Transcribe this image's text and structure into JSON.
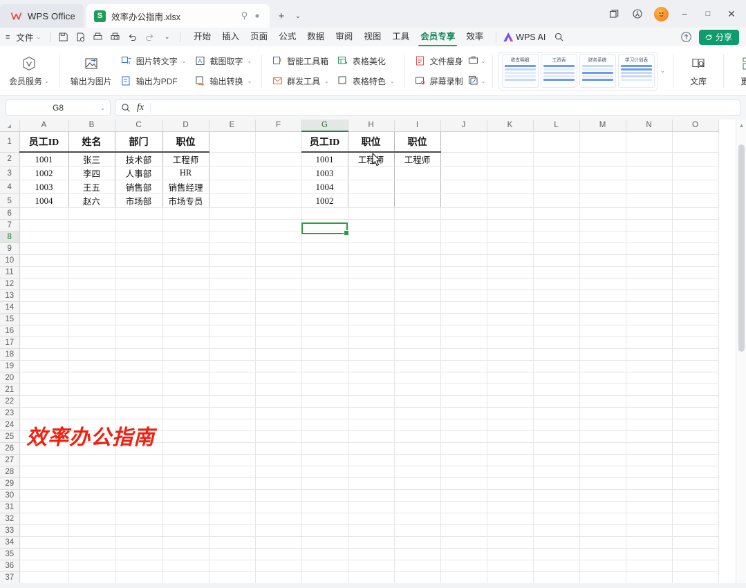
{
  "titlebar": {
    "brand": "WPS Office",
    "doc_tab": {
      "title": "效率办公指南.xlsx",
      "pin_icon": "pin-icon",
      "dot_icon": "unsaved-dot-icon"
    },
    "add_tab": "+",
    "tab_list_caret": "⌄",
    "window": {
      "restore_multi_icon": "multi-window-icon",
      "help_icon": "help-circle-icon",
      "avatar_icon": "user-avatar",
      "minimize": "−",
      "maximize": "□",
      "close": "✕"
    }
  },
  "menubar": {
    "hamburger": "≡",
    "file_label": "文件",
    "quick_access": [
      "save-icon",
      "save-as-icon",
      "print-icon",
      "print-preview-icon",
      "undo-icon",
      "redo-icon",
      "qat-more-icon"
    ],
    "tabs": [
      {
        "label": "开始",
        "active": false
      },
      {
        "label": "插入",
        "active": false
      },
      {
        "label": "页面",
        "active": false
      },
      {
        "label": "公式",
        "active": false
      },
      {
        "label": "数据",
        "active": false
      },
      {
        "label": "审阅",
        "active": false
      },
      {
        "label": "视图",
        "active": false
      },
      {
        "label": "工具",
        "active": false
      },
      {
        "label": "会员专享",
        "active": true
      },
      {
        "label": "效率",
        "active": false
      }
    ],
    "ai_label": "WPS AI",
    "search_icon": "search-icon",
    "cloud_icon": "cloud-upload-icon",
    "share_label": "分享",
    "share_color": "#0f9b6c"
  },
  "ribbon": {
    "member_service": {
      "label": "会员服务",
      "icon": "vip-badge-icon",
      "caret": "⌄"
    },
    "export_image": {
      "label": "输出为图片",
      "icon": "export-image-icon"
    },
    "stack1": [
      {
        "label": "图片转文字",
        "icon": "image-to-text-icon",
        "caret": "⌄"
      },
      {
        "label": "输出为PDF",
        "icon": "export-pdf-icon",
        "caret": ""
      }
    ],
    "stack2": [
      {
        "label": "截图取字",
        "icon": "screenshot-ocr-icon",
        "caret": "⌄"
      },
      {
        "label": "输出转换",
        "icon": "format-convert-icon",
        "caret": "⌄"
      }
    ],
    "stack3": [
      {
        "label": "智能工具箱",
        "icon": "smart-toolbox-icon",
        "caret": ""
      },
      {
        "label": "群发工具",
        "icon": "mass-mail-icon",
        "caret": "⌄"
      }
    ],
    "stack4": [
      {
        "label": "表格美化",
        "icon": "table-beautify-icon",
        "caret": ""
      },
      {
        "label": "表格特色",
        "icon": "table-feature-icon",
        "caret": "⌄"
      }
    ],
    "stack5": [
      {
        "label": "文件瘦身",
        "icon": "file-slim-icon",
        "caret": ""
      },
      {
        "label": "屏幕录制",
        "icon": "screen-record-icon",
        "caret": ""
      }
    ],
    "stack6": [
      {
        "label": "",
        "icon": "toolbox-more-icon",
        "caret": "⌄"
      },
      {
        "label": "",
        "icon": "doc-sign-icon",
        "caret": "⌄"
      }
    ],
    "templates": [
      {
        "name": "收支明细"
      },
      {
        "name": "工资表"
      },
      {
        "name": "财务系统"
      },
      {
        "name": "学习计划表"
      }
    ],
    "templates_more": "⌄",
    "library": {
      "label": "文库",
      "icon": "library-search-icon"
    },
    "more": {
      "label": "更多",
      "icon": "more-grid-icon"
    }
  },
  "formulabar": {
    "namebox_value": "G8",
    "namebox_caret": "⌄",
    "zoom_icon": "zoom-search-icon",
    "fx_label": "fx",
    "formula_value": ""
  },
  "sheet": {
    "corner_icon": "select-all-triangle",
    "columns": [
      "A",
      "B",
      "C",
      "D",
      "E",
      "F",
      "G",
      "H",
      "I",
      "J",
      "K",
      "L",
      "M",
      "N",
      "O"
    ],
    "selected_column": "G",
    "selected_row": 8,
    "selected_cell": "G8",
    "row_count": 37,
    "rows": [
      {
        "n": 1,
        "cells": {
          "A": "员工ID",
          "B": "姓名",
          "C": "部门",
          "D": "职位",
          "G": "员工ID",
          "H": "职位",
          "I": "职位"
        },
        "header": true
      },
      {
        "n": 2,
        "cells": {
          "A": "1001",
          "B": "张三",
          "C": "技术部",
          "D": "工程师",
          "G": "1001",
          "H": "工程师",
          "I": "工程师"
        }
      },
      {
        "n": 3,
        "cells": {
          "A": "1002",
          "B": "李四",
          "C": "人事部",
          "D": "HR",
          "G": "1003"
        }
      },
      {
        "n": 4,
        "cells": {
          "A": "1003",
          "B": "王五",
          "C": "销售部",
          "D": "销售经理",
          "G": "1004"
        }
      },
      {
        "n": 5,
        "cells": {
          "A": "1004",
          "B": "赵六",
          "C": "市场部",
          "D": "市场专员",
          "G": "1002"
        }
      }
    ],
    "watermark": {
      "text": "效率办公指南",
      "color": "#ee2211",
      "cell": "A26"
    },
    "cursor": {
      "type": "arrow-pointer",
      "over_cell": "H2"
    },
    "scrollbar": {
      "up_arrow": "▲",
      "down_arrow": "▼"
    }
  }
}
